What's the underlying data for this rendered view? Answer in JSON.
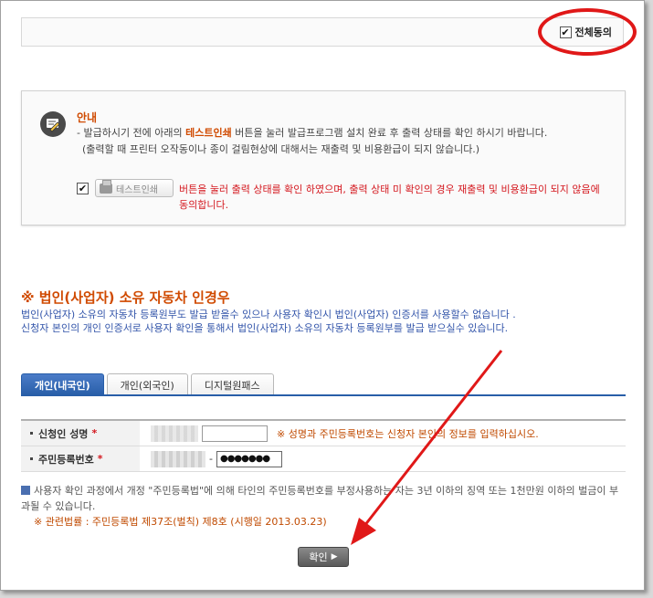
{
  "agree_all": {
    "label": "전체동의",
    "checked": true
  },
  "notice": {
    "title": "안내",
    "line1_pre": "- 발급하시기 전에 아래의 ",
    "line1_strong": "테스트인쇄",
    "line1_post": " 버튼을 눌러 발급프로그램 설치 완료 후 출력 상태를 확인 하시기 바랍니다.",
    "line2": "(출력할 때 프린터 오작동이나 종이 걸림현상에 대해서는 재출력 및 비용환급이 되지 않습니다.)",
    "test_print_button": "테스트인쇄",
    "warning": "버튼을 눌러 출력 상태를 확인 하였으며, 출력 상태 미 확인의 경우 재출력 및 비용환급이 되지 않음에 동의합니다."
  },
  "corporate": {
    "title": "※ 법인(사업자) 소유 자동차 인경우",
    "desc1": "법인(사업자) 소유의 자동차 등록원부도 발급 받을수 있으나 사용자 확인시 법인(사업자) 인증서를 사용할수 없습니다 .",
    "desc2": "신청자 본인의 개인 인증서로 사용자 확인을 통해서 법인(사업자) 소유의 자동차 등록원부를 발급 받으실수 있습니다."
  },
  "tabs": [
    {
      "label": "개인(내국인)",
      "active": true
    },
    {
      "label": "개인(외국인)",
      "active": false
    },
    {
      "label": "디지털원패스",
      "active": false
    }
  ],
  "form": {
    "name_label": "신청인 성명",
    "rrn_label": "주민등록번호",
    "required_mark": "*",
    "hint": "※ 성명과 주민등록번호는 신청자 본인의 정보를 입력하십시오.",
    "rrn_dash": "-",
    "rrn_masked": "●●●●●●●"
  },
  "law": {
    "text": "사용자 확인 과정에서 개정 \"주민등록법\"에 의해 타인의 주민등록번호를 부정사용하는 자는 3년 이하의 징역 또는 1천만원 이하의 벌금이 부과될 수 있습니다.",
    "reference": "※ 관련법률 : 주민등록법 제37조(벌칙) 제8호 (시행일 2013.03.23)"
  },
  "confirm_button": "확인",
  "colors": {
    "accent_orange": "#d04a00",
    "warning_red": "#d4181f",
    "tab_blue": "#285ea8",
    "annotation_red": "#e01818"
  }
}
